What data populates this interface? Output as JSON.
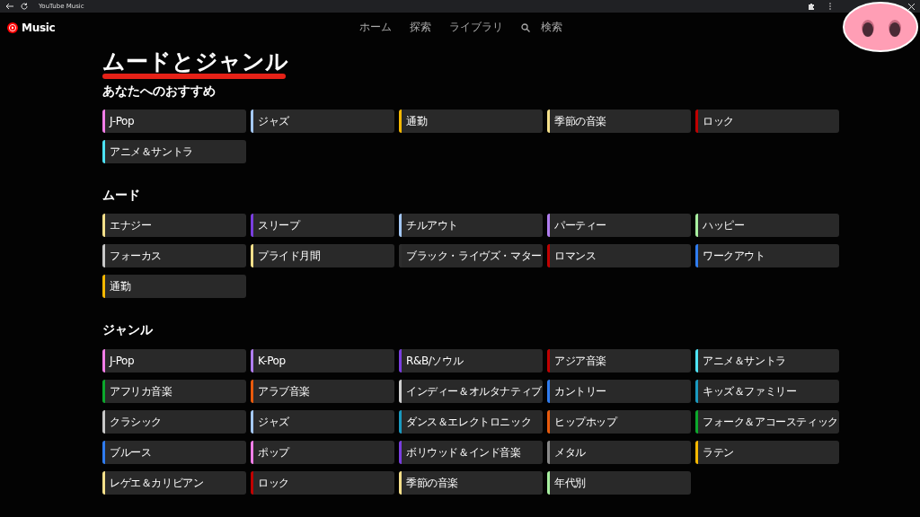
{
  "browser_bar": {
    "title": "YouTube Music"
  },
  "app_header": {
    "logo_text": "Music",
    "nav": [
      {
        "label": "ホーム",
        "kind": "link"
      },
      {
        "label": "探索",
        "kind": "link"
      },
      {
        "label": "ライブラリ",
        "kind": "link"
      },
      {
        "label": "検索",
        "kind": "search"
      }
    ]
  },
  "page_title": "ムードとジャンル",
  "sections": [
    {
      "title": "あなたへのおすすめ",
      "items": [
        {
          "label": "J-Pop",
          "color": "#f27ee8"
        },
        {
          "label": "ジャズ",
          "color": "#a4c8f6"
        },
        {
          "label": "通勤",
          "color": "#f5b800"
        },
        {
          "label": "季節の音楽",
          "color": "#f5e08a"
        },
        {
          "label": "ロック",
          "color": "#c00000"
        },
        {
          "label": "アニメ＆サントラ",
          "color": "#4de3f5"
        }
      ]
    },
    {
      "title": "ムード",
      "items": [
        {
          "label": "エナジー",
          "color": "#f5e08a"
        },
        {
          "label": "スリープ",
          "color": "#7a3ee0"
        },
        {
          "label": "チルアウト",
          "color": "#a4c8f6"
        },
        {
          "label": "パーティー",
          "color": "#b07df0"
        },
        {
          "label": "ハッピー",
          "color": "#a8f0a0"
        },
        {
          "label": "フォーカス",
          "color": "#c8c8c8"
        },
        {
          "label": "プライド月間",
          "color": "#f5e08a"
        },
        {
          "label": "ブラック・ライヴズ・マター",
          "color": "#2e2e2e"
        },
        {
          "label": "ロマンス",
          "color": "#c00000"
        },
        {
          "label": "ワークアウト",
          "color": "#2f7cf0"
        },
        {
          "label": "通勤",
          "color": "#f5b800"
        }
      ]
    },
    {
      "title": "ジャンル",
      "items": [
        {
          "label": "J-Pop",
          "color": "#f27ee8"
        },
        {
          "label": "K-Pop",
          "color": "#b07df0"
        },
        {
          "label": "R&B/ソウル",
          "color": "#7a3ee0"
        },
        {
          "label": "アジア音楽",
          "color": "#c00000"
        },
        {
          "label": "アニメ＆サントラ",
          "color": "#4de3f5"
        },
        {
          "label": "アフリカ音楽",
          "color": "#0ca82c"
        },
        {
          "label": "アラブ音楽",
          "color": "#e85a0c"
        },
        {
          "label": "インディー＆オルタナティブ",
          "color": "#d0d0d0"
        },
        {
          "label": "カントリー",
          "color": "#2f7cf0"
        },
        {
          "label": "キッズ＆ファミリー",
          "color": "#1a9ac0"
        },
        {
          "label": "クラシック",
          "color": "#c8c8c8"
        },
        {
          "label": "ジャズ",
          "color": "#a4c8f6"
        },
        {
          "label": "ダンス＆エレクトロニック",
          "color": "#1a9ac0"
        },
        {
          "label": "ヒップホップ",
          "color": "#e85a0c"
        },
        {
          "label": "フォーク＆アコースティック",
          "color": "#0ca82c"
        },
        {
          "label": "ブルース",
          "color": "#2f7cf0"
        },
        {
          "label": "ポップ",
          "color": "#f27ee8"
        },
        {
          "label": "ボリウッド＆インド音楽",
          "color": "#7a3ee0"
        },
        {
          "label": "メタル",
          "color": "#8a8a8a"
        },
        {
          "label": "ラテン",
          "color": "#f5b800"
        },
        {
          "label": "レゲエ＆カリビアン",
          "color": "#f5e08a"
        },
        {
          "label": "ロック",
          "color": "#c00000"
        },
        {
          "label": "季節の音楽",
          "color": "#f5e08a"
        },
        {
          "label": "年代別",
          "color": "#a8f0a0"
        }
      ]
    }
  ]
}
